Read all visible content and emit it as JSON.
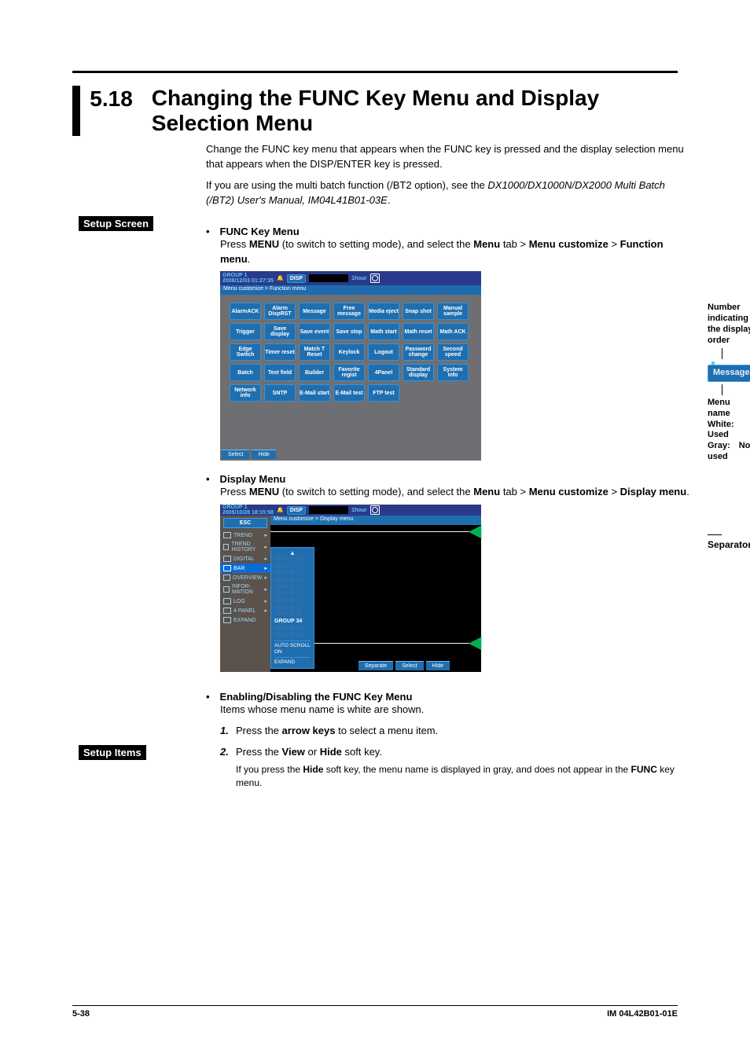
{
  "section_number": "5.18",
  "section_title": "Changing the FUNC Key Menu and Display Selection Menu",
  "intro1": "Change the FUNC key menu that appears when the FUNC key is pressed and the display selection menu that appears when the DISP/ENTER key is pressed.",
  "intro2a": "If you are using the multi batch function (/BT2 option), see the ",
  "intro2b": "DX1000/DX1000N/DX2000 Multi Batch (/BT2) User's Manual, IM04L41B01-03E",
  "intro2c": ".",
  "label_setup_screen": "Setup Screen",
  "label_setup_items": "Setup Items",
  "func_head": "• FUNC Key Menu",
  "func_instr1": "Press ",
  "func_instr2": " (to switch to setting mode), and select the ",
  "func_instr3": " tab > ",
  "func_instr4": " > ",
  "func_instr5": ".",
  "menu_b": "MENU",
  "tab_b": "Menu",
  "mc_b": "Menu customize",
  "fm_b": "Function menu",
  "dm_b": "Display menu",
  "display_head": "• Display Menu",
  "call_num": "Number indicating the display order",
  "call_btn": "Message",
  "call_name": "Menu name",
  "call_white": "White: Used",
  "call_gray": "Gray: Not used",
  "separator": "Separator",
  "enable_head": "• Enabling/Disabling the FUNC Key Menu",
  "enable_sub": "Items whose menu name is white are shown.",
  "step1": "Press the ",
  "step1b": "arrow keys",
  "step1c": " to select a menu item.",
  "step2": "Press the ",
  "step2b": "View",
  "step2c": " or ",
  "step2d": "Hide",
  "step2e": " soft key.",
  "step2note1": "If you press the ",
  "step2note2": " soft key, the menu name is displayed in gray, and does not appear in the ",
  "step2note3": " key menu.",
  "func_b": "FUNC",
  "hide_b": "Hide",
  "s1": {
    "group": "GROUP 1",
    "dt": "2008/12/03 01:27:35",
    "disp": "DISP",
    "range": "1hour",
    "crumb": "Menu customize > Function menu",
    "btns": [
      "AlarmACK",
      "Alarm DispRST",
      "Message",
      "Free message",
      "Media eject",
      "Snap shot",
      "Manual sample",
      "Trigger",
      "Save display",
      "Save event",
      "Save stop",
      "Math start",
      "Math reset",
      "Math ACK",
      "Edge Switch",
      "Timer reset",
      "Match T Reset",
      "Keylock",
      "Logout",
      "Password change",
      "Second speed",
      "Batch",
      "Text field",
      "Builder",
      "Favorite regist",
      "4Panel",
      "Standard display",
      "System info",
      "Network info",
      "SNTP",
      "E-Mail start",
      "E-Mail test",
      "FTP test"
    ],
    "soft": [
      "Select",
      "Hide"
    ]
  },
  "s2": {
    "group": "GROUP 1",
    "dt": "2005/10/28 18:15:58",
    "disp": "DISP",
    "range": "1hour",
    "crumb": "Menu customize > Display menu",
    "left": [
      "TREND",
      "TREND HISTORY",
      "DIGITAL",
      "BAR",
      "OVERVIEW",
      "INFOR-MATION",
      "LOG",
      "4 PANEL",
      "EXPAND"
    ],
    "esc": "ESC",
    "panel": [
      "GROUP 25",
      "GROUP 26",
      "GROUP 27",
      "GROUP 28",
      "GROUP 29",
      "GROUP 30",
      "GROUP 31",
      "GROUP 32",
      "GROUP 33",
      "GROUP 34",
      "GROUP 35",
      "GROUP 36",
      "AUTO SCROLL ON",
      "EXPAND"
    ],
    "cur": "GROUP 34",
    "soft": [
      "Separate",
      "Select",
      "Hide"
    ]
  },
  "footer_page": "5-38",
  "footer_doc": "IM 04L42B01-01E"
}
